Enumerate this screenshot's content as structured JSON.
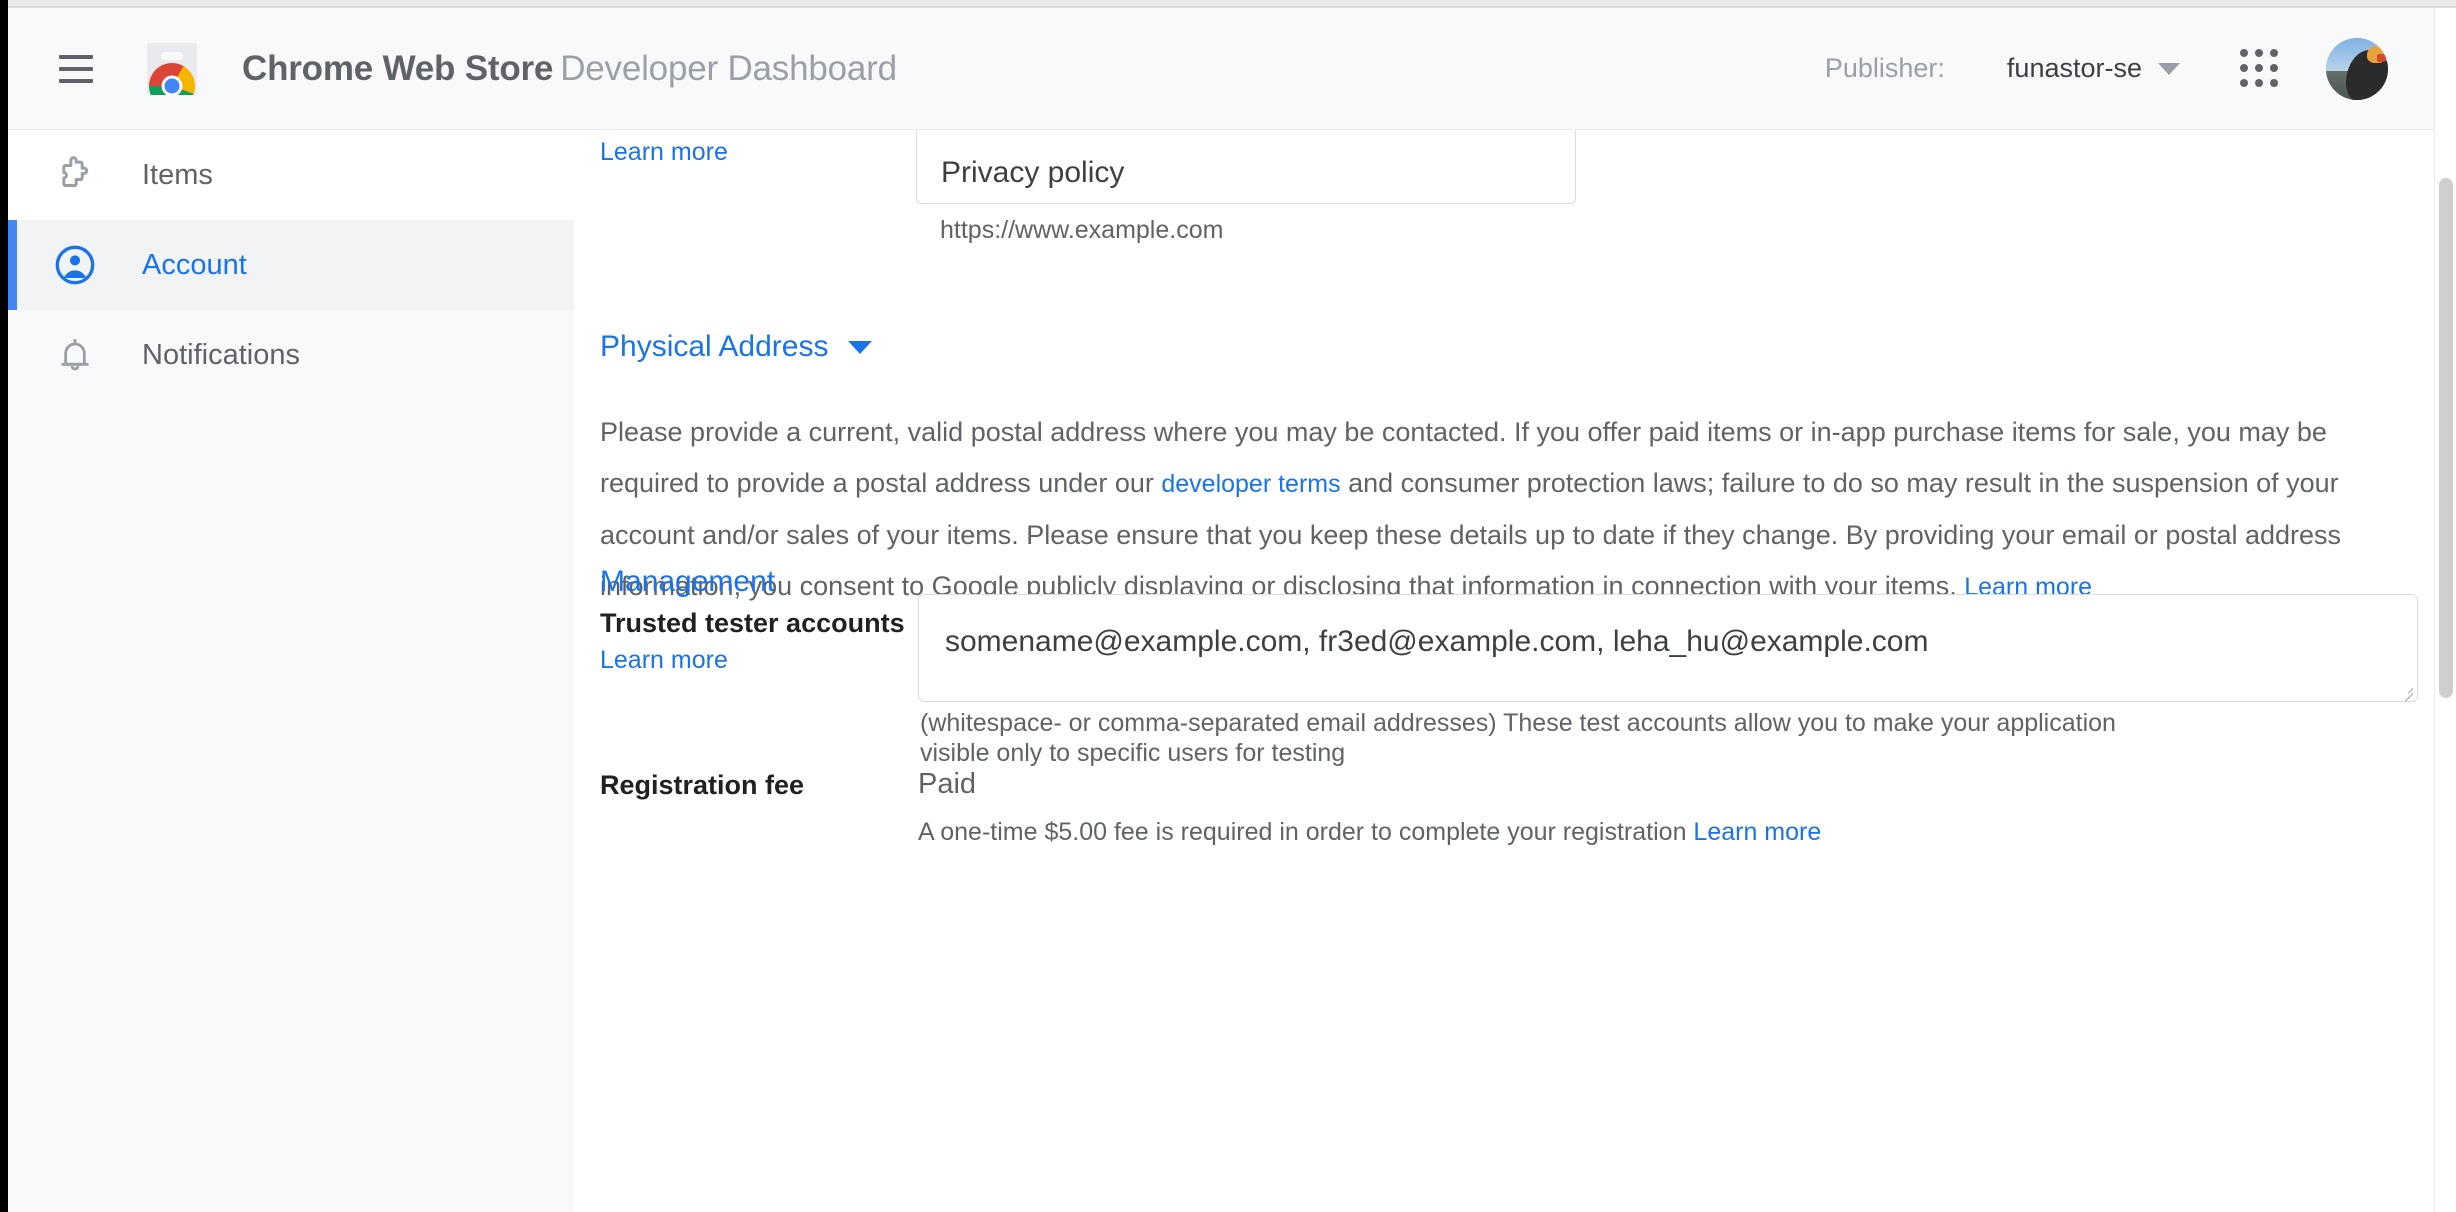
{
  "appbar": {
    "menu_icon": "hamburger-menu-icon",
    "logo_icon": "chrome-web-store-logo",
    "title_strong": "Chrome Web Store",
    "title_light": "Developer Dashboard",
    "publisher_label": "Publisher:",
    "publisher_value": "funastor-se",
    "publisher_caret_icon": "chevron-down-icon",
    "apps_icon": "google-apps-grid-icon",
    "avatar_icon": "user-avatar"
  },
  "sidebar": {
    "items": [
      {
        "label": "Items",
        "icon": "puzzle-piece-icon",
        "active": false
      },
      {
        "label": "Account",
        "icon": "account-circle-icon",
        "active": true
      },
      {
        "label": "Notifications",
        "icon": "bell-icon",
        "active": false
      }
    ]
  },
  "content": {
    "privacy": {
      "learn_more": "Learn more",
      "field_text": "Privacy policy",
      "hint": "https://www.example.com"
    },
    "physical_address": {
      "heading": "Physical Address",
      "paragraph_part_1": "Please provide a current, valid postal address where you may be contacted. If you offer paid items or in-app purchase items for sale, you may be required to provide a postal address under our ",
      "paragraph_link_1": "developer terms",
      "paragraph_part_2": " and consumer protection laws; failure to do so may result in the suspension of your account and/or sales of your items. Please ensure that you keep these details up to date if they change. By providing your email or postal address information, you consent to Google publicly displaying or disclosing that information in connection with your items. ",
      "paragraph_link_2": "Learn more"
    },
    "management": {
      "heading": "Management",
      "trusted_tester": {
        "label": "Trusted tester accounts",
        "learn_more": "Learn more",
        "value": "somename@example.com, fr3ed@example.com, leha_hu@example.com",
        "hint": "(whitespace- or comma-separated email addresses) These test accounts allow you to make your application visible only to specific users for testing"
      },
      "registration_fee": {
        "label": "Registration fee",
        "value": "Paid",
        "note": "A one-time $5.00 fee is required in order to complete your registration ",
        "note_link": "Learn more"
      }
    }
  },
  "colors": {
    "accent_blue": "#1a73e8",
    "active_bar": "#4285f4",
    "text_primary": "#202124",
    "text_secondary": "#5f6368",
    "text_muted": "#9aa0a6",
    "sidebar_bg": "#f8f9fa",
    "appbar_bg": "#f8f9fa"
  }
}
